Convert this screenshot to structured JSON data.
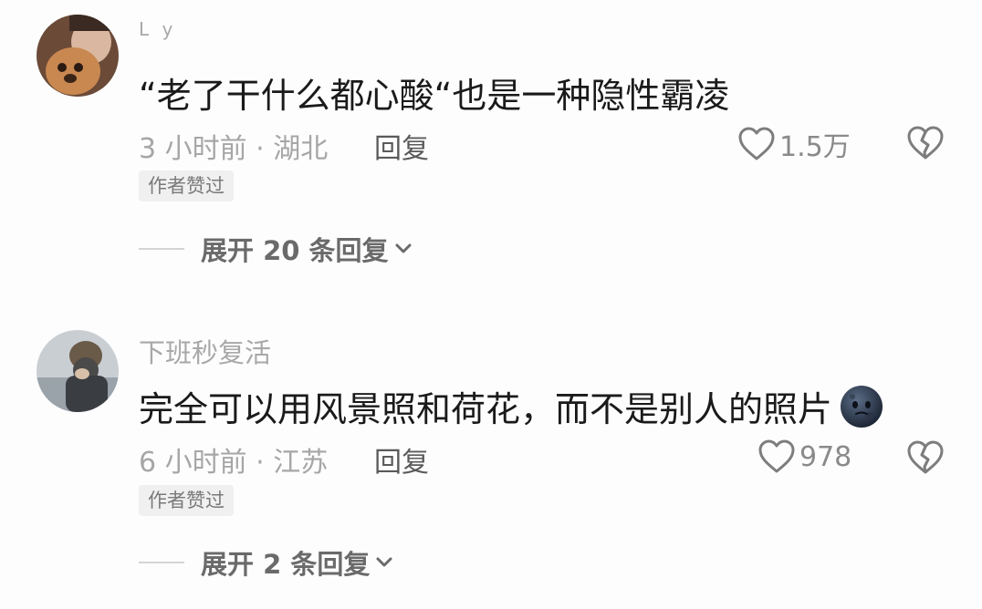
{
  "comments": [
    {
      "username": "L y",
      "text": "“老了干什么都心酸“也是一种隐性霸凌",
      "time_location": "3 小时前 · 湖北",
      "reply_label": "回复",
      "likes": "1.5万",
      "author_badge": "作者赞过",
      "expand_label": "展开 20 条回复"
    },
    {
      "username": "下班秒复活",
      "text": "完全可以用风景照和荷花，而不是别人的照片",
      "emoji": "moon-face-emoji",
      "time_location": "6 小时前 · 江苏",
      "reply_label": "回复",
      "likes": "978",
      "author_badge": "作者赞过",
      "expand_label": "展开 2 条回复"
    }
  ],
  "icons": {
    "like": "heart-outline-icon",
    "dislike": "broken-heart-icon",
    "expand": "chevron-down-icon"
  }
}
